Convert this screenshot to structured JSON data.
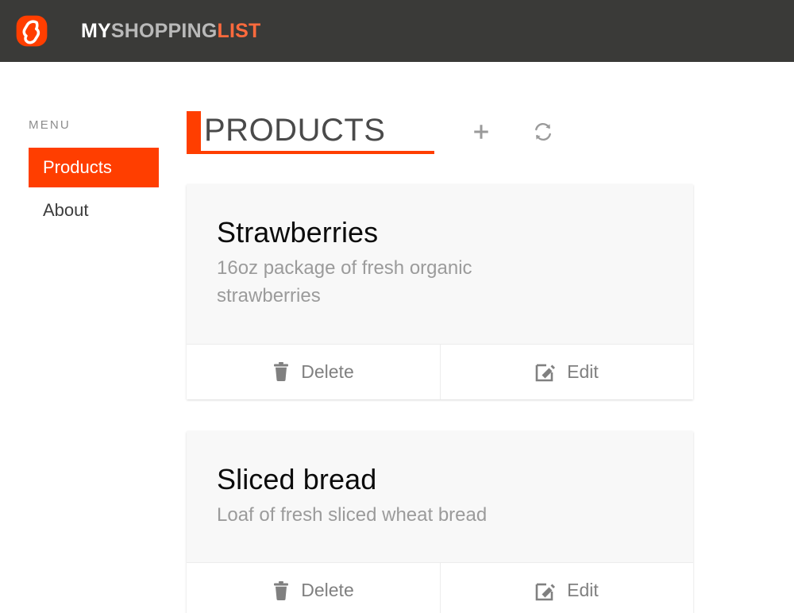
{
  "header": {
    "logo_icon": "svelte-s-logo-icon",
    "brand": {
      "part1": "MY",
      "part2": "SHOPPING",
      "part3": "LIST"
    },
    "background_color": "#3a3a38",
    "accent_color": "#ff3e00"
  },
  "sidebar": {
    "label": "MENU",
    "items": [
      {
        "label": "Products",
        "active": true
      },
      {
        "label": "About",
        "active": false
      }
    ]
  },
  "main": {
    "title": "PRODUCTS",
    "actions": [
      {
        "name": "add-product-button",
        "icon": "plus-icon"
      },
      {
        "name": "refresh-products-button",
        "icon": "refresh-icon"
      }
    ],
    "product_actions": {
      "delete_label": "Delete",
      "delete_icon": "trash-icon",
      "edit_label": "Edit",
      "edit_icon": "edit-pencil-square-icon"
    },
    "products": [
      {
        "name": "Strawberries",
        "description": "16oz package of fresh organic strawberries"
      },
      {
        "name": "Sliced bread",
        "description": "Loaf of fresh sliced wheat bread"
      }
    ]
  },
  "colors": {
    "accent": "#ff3e00",
    "header_bg": "#3a3a38",
    "card_bg": "#f8f8f8",
    "muted_text": "#9b9b9b"
  }
}
